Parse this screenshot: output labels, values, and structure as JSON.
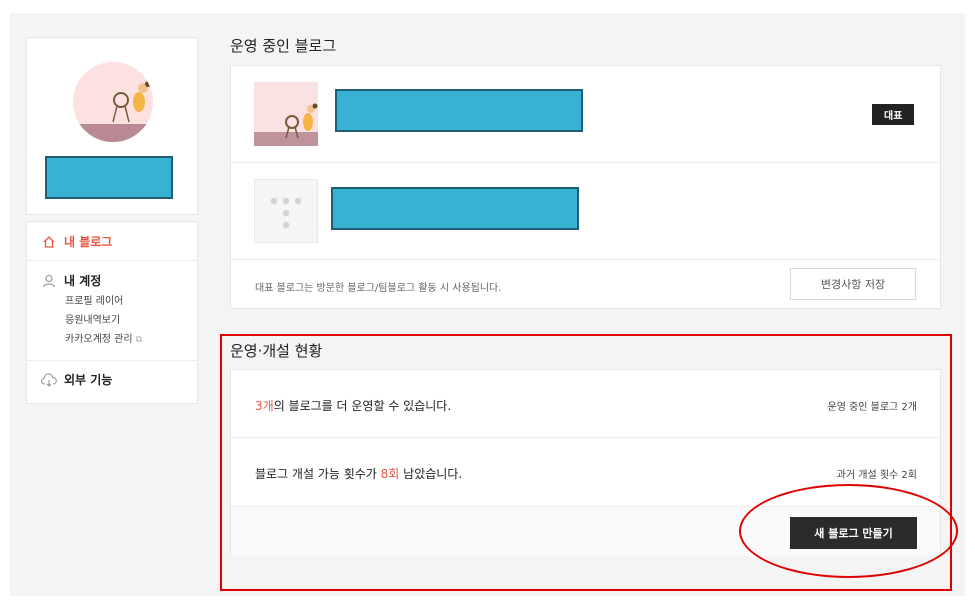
{
  "sidebar": {
    "menu": {
      "my_blog": "내 블로그",
      "my_account": "내 계정",
      "account_links": [
        "프로필 레이어",
        "응원내역보기",
        "카카오계정 관리"
      ],
      "external": "외부 기능"
    }
  },
  "blogs_section": {
    "title": "운영 중인 블로그",
    "representative_badge": "대표",
    "note": "대표 블로그는 방문한 블로그/팀블로그 활동 시 사용됩니다.",
    "save_button": "변경사항 저장"
  },
  "status_section": {
    "title": "운영·개설 현황",
    "row1": {
      "count": "3개",
      "text": "의 블로그를 더 운영할 수 있습니다.",
      "side": "운영 중인 블로그 2개"
    },
    "row2": {
      "prefix": "블로그 개설 가능 횟수가 ",
      "count": "8회",
      "suffix": " 남았습니다.",
      "side": "과거 개설 횟수 2회"
    },
    "new_button": "새 블로그 만들기"
  },
  "colors": {
    "accent": "#e8553f",
    "redaction": "#38b2d3",
    "annotation": "#e00000"
  },
  "icons": [
    "home-icon",
    "person-icon",
    "external-link-icon",
    "cloud-download-icon"
  ]
}
